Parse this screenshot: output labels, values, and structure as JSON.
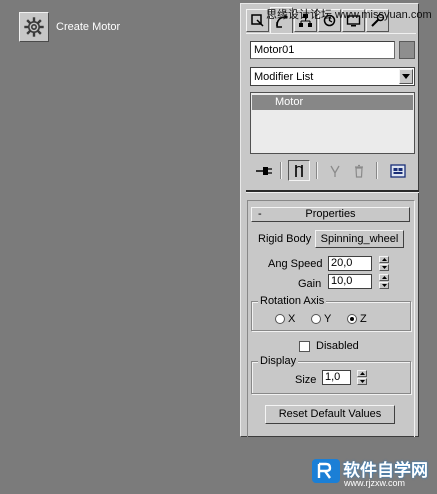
{
  "toolbar": {
    "create_motor_label": "Create Motor",
    "create_motor_icon": "gear-icon"
  },
  "panel": {
    "tabs": [
      {
        "icon": "create-icon"
      },
      {
        "icon": "modify-icon"
      },
      {
        "icon": "hierarchy-icon"
      },
      {
        "icon": "motion-icon"
      },
      {
        "icon": "display-icon"
      },
      {
        "icon": "utilities-icon"
      }
    ],
    "object_name": "Motor01",
    "object_color": "#8e8e8e",
    "modifier_list": "Modifier List",
    "stack_items": [
      "Motor"
    ],
    "stack_tools": [
      {
        "icon": "pin-stack-icon"
      },
      {
        "icon": "show-end-result-icon"
      },
      {
        "icon": "make-unique-icon"
      },
      {
        "icon": "remove-modifier-icon"
      },
      {
        "icon": "configure-modifier-sets-icon"
      }
    ]
  },
  "properties": {
    "rollout_toggle": "-",
    "rollout_title": "Properties",
    "rigid_body_label": "Rigid Body",
    "rigid_body_value": "Spinning_wheel",
    "ang_speed_label": "Ang Speed",
    "ang_speed_value": "20,0",
    "gain_label": "Gain",
    "gain_value": "10,0",
    "rotation_axis_title": "Rotation Axis",
    "axis_x": "X",
    "axis_y": "Y",
    "axis_z": "Z",
    "selected_axis": "Z",
    "disabled_label": "Disabled",
    "disabled_checked": false,
    "display_title": "Display",
    "size_label": "Size",
    "size_value": "1,0",
    "reset_label": "Reset Default Values"
  },
  "watermark": {
    "top_text": "思缘设计论坛 www.missyuan.com",
    "brand_text": "软件自学网",
    "url_text": "www.rjzxw.com"
  }
}
